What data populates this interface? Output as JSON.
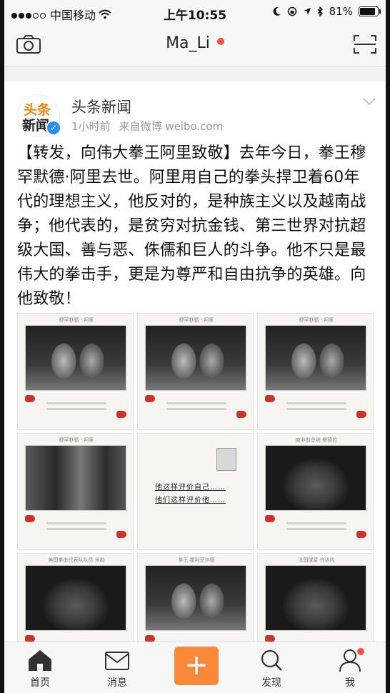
{
  "status_bar": {
    "carrier": "中国移动",
    "time": "上午10:55",
    "battery": "81%"
  },
  "nav": {
    "title": "Ma_Li"
  },
  "post": {
    "author": "头条新闻",
    "avatar_line1": "头条",
    "avatar_line2": "新闻",
    "time_ago": "1小时前",
    "source": "来自微博 weibo.com",
    "text": "【转发，向伟大拳王阿里致敬】去年今日，拳王穆罕默德·阿里去世。阿里用自己的拳头捍卫着60年代的理想主义，他反对的，是种族主义以及越南战争；他代表的，是贫穷对抗金钱、第三世界对抗超级大国、善与恶、侏儒和巨人的斗争。他不只是最伟大的拳击手，更是为尊严和自由抗争的英雄。向他致敬！",
    "images": [
      {
        "caption": "穆罕默德 · 阿里",
        "kind": "boxing-photo"
      },
      {
        "caption": "穆罕默德 · 阿里",
        "kind": "boxing-photo"
      },
      {
        "caption": "穆罕默德 · 阿里",
        "kind": "boxing-photo"
      },
      {
        "caption": "穆罕默德 · 阿里",
        "kind": "group-photo"
      },
      {
        "caption": "",
        "kind": "text-card",
        "line1": "他这样评价自己……",
        "line2": "他们这样评价他……"
      },
      {
        "caption": "南非前总统 曼德拉",
        "kind": "portrait"
      },
      {
        "caption": "美国拳击代表队队员 米勒",
        "kind": "portrait"
      },
      {
        "caption": "拳王 霍利菲尔德",
        "kind": "boxing-photo"
      },
      {
        "caption": "法国球星 齐达内",
        "kind": "portrait"
      }
    ]
  },
  "tabs": [
    {
      "label": "首页",
      "icon": "home-icon"
    },
    {
      "label": "消息",
      "icon": "mail-icon"
    },
    {
      "label": "",
      "icon": "plus-icon"
    },
    {
      "label": "发现",
      "icon": "search-icon"
    },
    {
      "label": "我",
      "icon": "user-icon"
    }
  ],
  "colors": {
    "accent_orange": "#f8893a",
    "notify_red": "#f5533d",
    "verified_blue": "#2e8ef5",
    "glove_red": "#c9332a"
  }
}
